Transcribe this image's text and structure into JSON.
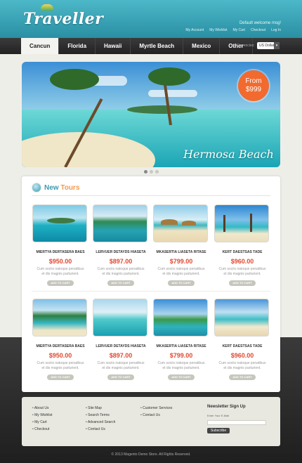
{
  "header": {
    "logo": "Traveller",
    "welcome": "Default welcome msg!",
    "links": [
      "My Account",
      "My Wishlist",
      "My Cart",
      "Checkout",
      "Log In"
    ]
  },
  "nav": {
    "items": [
      "Cancun",
      "Florida",
      "Hawaii",
      "Myrtle Beach",
      "Mexico",
      "Other"
    ],
    "active": "Cancun",
    "currency_label": "Currencies:",
    "currency_value": "US Dollar"
  },
  "hero": {
    "badge_from": "From",
    "badge_price": "$999",
    "caption": "Hermosa Beach"
  },
  "section": {
    "title_a": "New ",
    "title_b": "Tours"
  },
  "cards": [
    {
      "name": "MIERTYA DERTASERA BAES",
      "price": "$950.00",
      "desc": "Cum sociis natoque penatibus et dis magnis parturient.",
      "btn": "ADD TO CART"
    },
    {
      "name": "LERVUER DETAYDS HIASETA",
      "price": "$897.00",
      "desc": "Cum sociis natoque penatibus et dis magnis parturient.",
      "btn": "ADD TO CART"
    },
    {
      "name": "MKASERTIA LIASETA RITASE",
      "price": "$799.00",
      "desc": "Cum sociis natoque penatibus et dis magnis parturient.",
      "btn": "ADD TO CART"
    },
    {
      "name": "KERT DAESTSAS TADE",
      "price": "$960.00",
      "desc": "Cum sociis natoque penatibus et dis magnis parturient.",
      "btn": "ADD TO CART"
    },
    {
      "name": "MIERTYA DERTASERA BAES",
      "price": "$950.00",
      "desc": "Cum sociis natoque penatibus et dis magnis parturient.",
      "btn": "ADD TO CART"
    },
    {
      "name": "LERVUER DETAYDS HIASETA",
      "price": "$897.00",
      "desc": "Cum sociis natoque penatibus et dis magnis parturient.",
      "btn": "ADD TO CART"
    },
    {
      "name": "MKASERTIA LIASETA RITASE",
      "price": "$799.00",
      "desc": "Cum sociis natoque penatibus et dis magnis parturient.",
      "btn": "ADD TO CART"
    },
    {
      "name": "KERT DAESTSAS TADE",
      "price": "$960.00",
      "desc": "Cum sociis natoque penatibus et dis magnis parturient.",
      "btn": "ADD TO CART"
    }
  ],
  "footer": {
    "col1": [
      "About Us",
      "My Wishlist",
      "My Cart",
      "Checkout"
    ],
    "col2": [
      "Site Map",
      "Search Terms",
      "Advanced Search",
      "Contact Us"
    ],
    "col3": [
      "Customer Services",
      "Contact Us"
    ],
    "newsletter_title": "Newsletter Sign Up",
    "newsletter_label": "Enter Your E-Mail",
    "newsletter_button": "Subscribe",
    "copyright": "© 2013 Magento Demo Store. All Rights Reserved."
  },
  "colors": {
    "accent": "#3c9ab0",
    "price": "#e2472f",
    "badge": "#f26a2e"
  }
}
